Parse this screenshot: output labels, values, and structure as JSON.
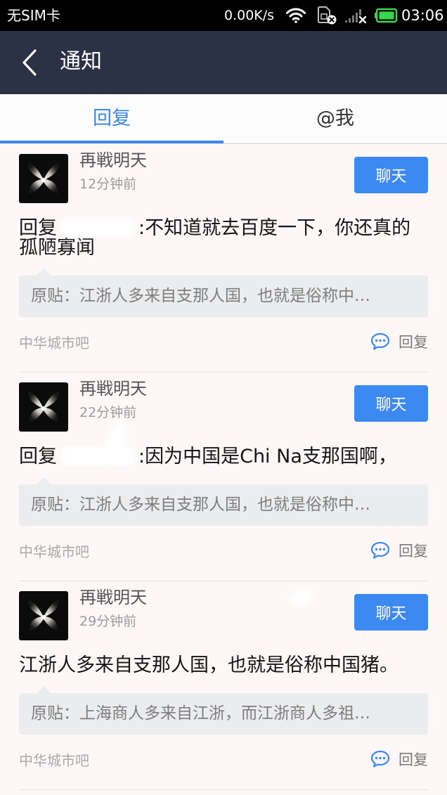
{
  "status_bar": {
    "carrier": "无SIM卡",
    "speed": "0.00K/s",
    "time": "03:06"
  },
  "header": {
    "title": "通知"
  },
  "tabs": [
    {
      "label": "回复",
      "active": true
    },
    {
      "label": "@我",
      "active": false
    }
  ],
  "icons": {
    "back": "back-chevron-icon",
    "wifi": "wifi-icon",
    "sim": "sim-error-icon",
    "signal": "signal-no-service-icon",
    "battery": "battery-icon",
    "reply": "comment-bubble-icon"
  },
  "colors": {
    "header_bg": "#2b3245",
    "accent": "#3b86e6",
    "button_bg": "#3c89f2",
    "quote_bg": "#ebecee",
    "list_bg": "#fdf8f7",
    "battery": "#37d64c"
  },
  "notifications": [
    {
      "user": "再戦明天",
      "time": "12分钟前",
      "chat_button": "聊天",
      "reply_prefix": "回复",
      "content": ":不知道就去百度一下，你还真的孤陋寡闻",
      "quote": "原贴：江浙人多来自支那人国，也就是俗称中…",
      "forum": "中华城市吧",
      "reply_button": "回复"
    },
    {
      "user": "再戦明天",
      "time": "22分钟前",
      "chat_button": "聊天",
      "reply_prefix": "回复",
      "content": ":因为中国是Chi Na支那国啊，",
      "quote": "原贴：江浙人多来自支那人国，也就是俗称中…",
      "forum": "中华城市吧",
      "reply_button": "回复"
    },
    {
      "user": "再戦明天",
      "time": "29分钟前",
      "chat_button": "聊天",
      "content": "江浙人多来自支那人国，也就是俗称中国猪。",
      "quote": "原贴：上海商人多来自江浙，而江浙商人多祖…",
      "forum": "中华城市吧",
      "reply_button": "回复"
    }
  ]
}
